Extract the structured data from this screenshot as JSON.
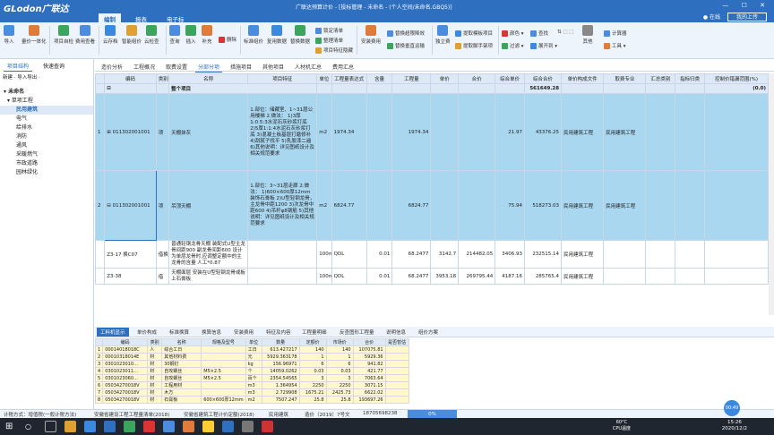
{
  "window": {
    "logo": "GLodon广联达",
    "title": "广联达预算计价 - [投标管理 - 未命名 - (个人空间/未命名.GBQ5)]"
  },
  "menu": {
    "items": [
      "编制",
      "报表",
      "电子标"
    ],
    "login": "在线",
    "cloud": "我的上传"
  },
  "ribbon": {
    "big": [
      "导入",
      "量价一体化",
      "项目自检",
      "费用查看",
      "云存档",
      "智能组价",
      "云检查",
      "查询",
      "插入",
      "补充",
      "删除",
      "标准组价",
      "复用数据",
      "替换数据",
      "安装费用",
      "独立费",
      "颜色",
      "展开到",
      "查找",
      "其他",
      "计算器",
      "工具"
    ],
    "small": [
      "锁定清单",
      "整理清单",
      "项目特征隐藏",
      "替换超限降效",
      "替换垂直运输",
      "提取模板项目",
      "提取脚手架项",
      "过滤"
    ]
  },
  "leftpanel": {
    "tabs": [
      "项目结构",
      "快速查询"
    ],
    "toolbar": "新建 · 导入导出 ·",
    "tree": [
      "未命名",
      "单项工程",
      "民用建筑",
      "电气",
      "给排水",
      "消防",
      "通风",
      "采暖燃气",
      "市政道路",
      "园林绿化"
    ]
  },
  "maintabs": [
    "造价分析",
    "工程概况",
    "取费设置",
    "分部分项",
    "措施项目",
    "其他项目",
    "人材机汇总",
    "费用汇总"
  ],
  "grid": {
    "headers": [
      "",
      "编码",
      "类别",
      "名称",
      "项目特征",
      "单位",
      "工程量表达式",
      "含量",
      "工程量",
      "单价",
      "合价",
      "综合单价",
      "综合合价",
      "单价构成文件",
      "取费专业",
      "汇总类别",
      "指标归类",
      "控制价错漏范围(%)"
    ],
    "sum_row": {
      "label": "整个项目",
      "total": "561649.28",
      "range": "(0.0)"
    },
    "rows": [
      {
        "no": "1",
        "code": "011302001001",
        "type": "项",
        "name": "天棚抹灰",
        "feature": "1.部位：储藏室、1~31层公用楼梯\n2.做法：\n1)3厚1:0.5:3水泥石灰砂浆打底\n2)5厚1:1:4水泥石灰砂浆打底\n3)混凝土板基层打磨修补\n4)刮腻子找平\n5)乳胶漆二遍\n6)其他说明：详见图纸设计及相关规范要求",
        "unit": "m2",
        "expr": "1974.34",
        "content": "",
        "qty": "1974.34",
        "price": "",
        "total": "",
        "comp_price": "21.97",
        "comp_total": "43376.25",
        "file": "民用建筑工程",
        "major": "民用建筑工程",
        "cat": "",
        "idx": ""
      },
      {
        "no": "2",
        "code": "011302001001",
        "type": "项",
        "name": "吊顶天棚",
        "feature": "1.部位：3~31层走廊\n2.做法：\n1)600×600厚12mm装饰石膏板\n2)U型轻钢龙骨，主龙骨中距1200\n3)次龙骨中距600\n4)吊杆φ8钢筋\n5)其他说明：详见图纸设计及相关规范要求",
        "unit": "m2",
        "expr": "6824.77",
        "content": "",
        "qty": "6824.77",
        "price": "",
        "total": "",
        "comp_price": "75.94",
        "comp_total": "518273.03",
        "file": "民用建筑工程",
        "major": "民用建筑工程",
        "cat": "",
        "idx": ""
      },
      {
        "no": "",
        "code": "Z3-17 换C07",
        "type": "借换",
        "name": "普通轻钢龙骨天棚 装配式U型主龙骨间距900 副龙骨间距600 设计为单层龙骨时,应调整定额中的主龙骨的含量 人工*0.87",
        "feature": "",
        "unit": "100m2",
        "expr": "QDL",
        "content": "0.01",
        "qty": "68.2477",
        "price": "3142.7",
        "total": "214482.05",
        "comp_price": "3406.93",
        "comp_total": "232515.14",
        "file": "民用建筑工程",
        "major": "",
        "cat": "",
        "idx": ""
      },
      {
        "no": "",
        "code": "Z3-38",
        "type": "借",
        "name": "天棚面层 安装在U型轻钢龙骨或板上石膏板",
        "feature": "",
        "unit": "100m2",
        "expr": "QDL",
        "content": "0.01",
        "qty": "68.2477",
        "price": "3953.18",
        "total": "269795.44",
        "comp_price": "4187.16",
        "comp_total": "285765.4",
        "file": "民用建筑工程",
        "major": "",
        "cat": "",
        "idx": ""
      }
    ]
  },
  "bottomtabs": [
    "工料机显示",
    "单价构成",
    "标准换算",
    "换算信息",
    "安装费用",
    "特征及内容",
    "工程量明细",
    "反查图形工程量",
    "说明信息",
    "组价方案"
  ],
  "bgrid": {
    "headers": [
      "",
      "编码",
      "类别",
      "名称",
      "规格及型号",
      "单位",
      "数量",
      "定额价",
      "市场价",
      "合价",
      "是否暂估"
    ],
    "rows": [
      [
        "1",
        "00014018018C",
        "人",
        "综合工日",
        "",
        "工日",
        "613.427217",
        "140",
        "140",
        "107075.81",
        ""
      ],
      [
        "2",
        "00010318014E",
        "材",
        "其他材料费",
        "",
        "元",
        "5929.363178",
        "1",
        "1",
        "5929.36",
        ""
      ],
      [
        "3",
        "0301023010…",
        "材",
        "30钢钉",
        "",
        "kg",
        "156.96971",
        "6",
        "6",
        "941.82",
        ""
      ],
      [
        "4",
        "0301023011…",
        "材",
        "自攻螺丝",
        "M5×2.5",
        "个",
        "14059.0262",
        "0.03",
        "0.03",
        "421.77",
        ""
      ],
      [
        "5",
        "0301023060…",
        "材",
        "自攻螺丝",
        "M5×2.5",
        "百个",
        "2354.54565",
        "3",
        "3",
        "7063.64",
        ""
      ],
      [
        "6",
        "05034270018V",
        "材",
        "工程用材",
        "",
        "m3",
        "1.364954",
        "2250",
        "2250",
        "3071.15",
        ""
      ],
      [
        "7",
        "05034270018V",
        "材",
        "木方",
        "",
        "m3",
        "2.729908",
        "1675.21",
        "2425.73",
        "6622.02",
        ""
      ],
      [
        "8",
        "05034270018V",
        "材",
        "石膏板",
        "600×600厚12mm",
        "m2",
        "7507.247",
        "25.8",
        "25.8",
        "193697.26",
        ""
      ]
    ]
  },
  "status": {
    "left": "计税方式：增值税(一般计税方法)",
    "s1": "安徽省建设工程工程量清单(2018)",
    "s2": "安徽省建筑工程计价定额(2018)",
    "s3": "民用建筑",
    "s4": "造价〔2019〕7号文",
    "s5": "18705698238",
    "blue": "0%"
  },
  "taskbar": {
    "temp": "60°C",
    "temp_label": "CPU温度",
    "time": "15:26",
    "date": "2020/12/2",
    "badge": "00:49"
  }
}
